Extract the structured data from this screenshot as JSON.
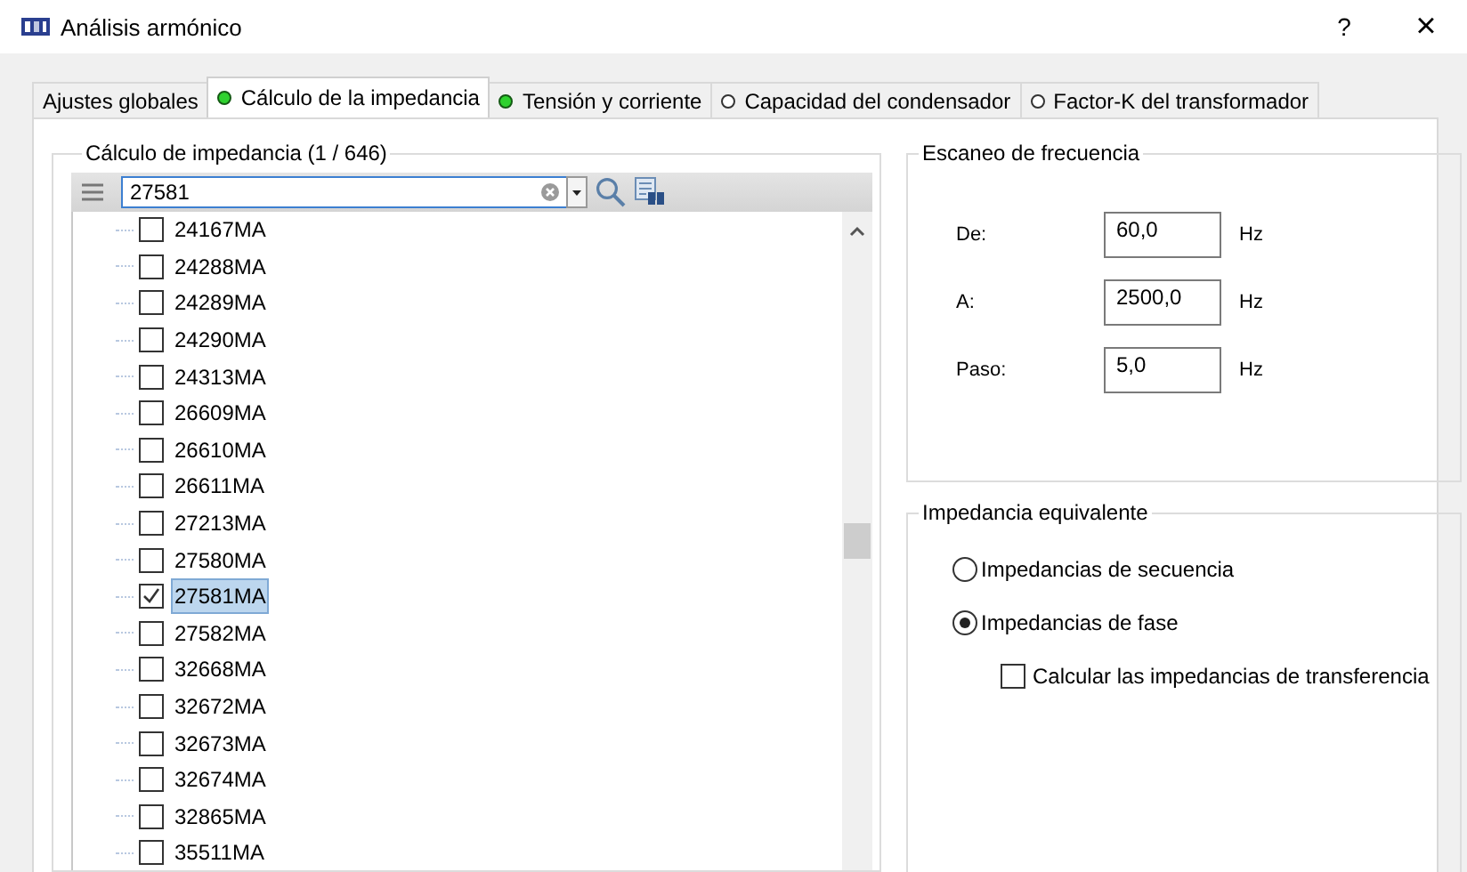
{
  "window": {
    "title": "Análisis armónico",
    "help": "?",
    "close": "×"
  },
  "tabs": [
    {
      "label": "Ajustes globales",
      "kind": "plain",
      "selected": false
    },
    {
      "label": "Cálculo de la impedancia",
      "kind": "indicator",
      "complete": true,
      "selected": true
    },
    {
      "label": "Tensión y corriente",
      "kind": "indicator",
      "complete": true,
      "selected": false
    },
    {
      "label": "Capacidad del condensador",
      "kind": "indicator",
      "complete": false,
      "selected": false
    },
    {
      "label": "Factor-K del transformador",
      "kind": "indicator",
      "complete": false,
      "selected": false
    }
  ],
  "impedance_group": {
    "title": "Cálculo de impedancia (1 / 646)",
    "search": {
      "value": "27581"
    },
    "items": [
      {
        "label": "24167MA",
        "checked": false,
        "selected": false
      },
      {
        "label": "24288MA",
        "checked": false,
        "selected": false
      },
      {
        "label": "24289MA",
        "checked": false,
        "selected": false
      },
      {
        "label": "24290MA",
        "checked": false,
        "selected": false
      },
      {
        "label": "24313MA",
        "checked": false,
        "selected": false
      },
      {
        "label": "26609MA",
        "checked": false,
        "selected": false
      },
      {
        "label": "26610MA",
        "checked": false,
        "selected": false
      },
      {
        "label": "26611MA",
        "checked": false,
        "selected": false
      },
      {
        "label": "27213MA",
        "checked": false,
        "selected": false
      },
      {
        "label": "27580MA",
        "checked": false,
        "selected": false
      },
      {
        "label": "27581MA",
        "checked": true,
        "selected": true
      },
      {
        "label": "27582MA",
        "checked": false,
        "selected": false
      },
      {
        "label": "32668MA",
        "checked": false,
        "selected": false
      },
      {
        "label": "32672MA",
        "checked": false,
        "selected": false
      },
      {
        "label": "32673MA",
        "checked": false,
        "selected": false
      },
      {
        "label": "32674MA",
        "checked": false,
        "selected": false
      },
      {
        "label": "32865MA",
        "checked": false,
        "selected": false
      },
      {
        "label": "35511MA",
        "checked": false,
        "selected": false
      }
    ]
  },
  "frequency_scan": {
    "title": "Escaneo de frecuencia",
    "fields": [
      {
        "label": "De:",
        "value": "60,0",
        "unit": "Hz"
      },
      {
        "label": "A:",
        "value": "2500,0",
        "unit": "Hz"
      },
      {
        "label": "Paso:",
        "value": "5,0",
        "unit": "Hz"
      }
    ]
  },
  "equivalent_impedance": {
    "title": "Impedancia equivalente",
    "options": [
      {
        "label": "Impedancias de secuencia",
        "selected": false
      },
      {
        "label": "Impedancias de fase",
        "selected": true
      }
    ],
    "transfer": {
      "label": "Calcular las impedancias de transferencia",
      "checked": false
    }
  }
}
